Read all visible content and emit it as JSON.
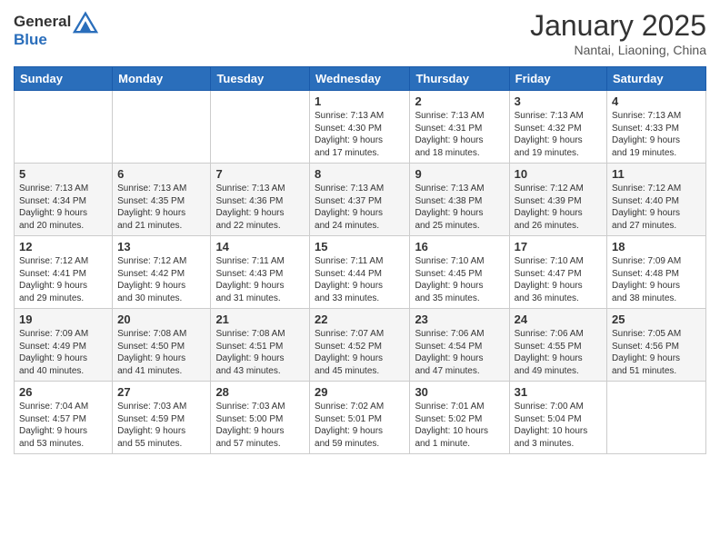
{
  "header": {
    "logo_line1": "General",
    "logo_line2": "Blue",
    "month": "January 2025",
    "location": "Nantai, Liaoning, China"
  },
  "weekdays": [
    "Sunday",
    "Monday",
    "Tuesday",
    "Wednesday",
    "Thursday",
    "Friday",
    "Saturday"
  ],
  "weeks": [
    [
      {
        "day": "",
        "info": ""
      },
      {
        "day": "",
        "info": ""
      },
      {
        "day": "",
        "info": ""
      },
      {
        "day": "1",
        "info": "Sunrise: 7:13 AM\nSunset: 4:30 PM\nDaylight: 9 hours\nand 17 minutes."
      },
      {
        "day": "2",
        "info": "Sunrise: 7:13 AM\nSunset: 4:31 PM\nDaylight: 9 hours\nand 18 minutes."
      },
      {
        "day": "3",
        "info": "Sunrise: 7:13 AM\nSunset: 4:32 PM\nDaylight: 9 hours\nand 19 minutes."
      },
      {
        "day": "4",
        "info": "Sunrise: 7:13 AM\nSunset: 4:33 PM\nDaylight: 9 hours\nand 19 minutes."
      }
    ],
    [
      {
        "day": "5",
        "info": "Sunrise: 7:13 AM\nSunset: 4:34 PM\nDaylight: 9 hours\nand 20 minutes."
      },
      {
        "day": "6",
        "info": "Sunrise: 7:13 AM\nSunset: 4:35 PM\nDaylight: 9 hours\nand 21 minutes."
      },
      {
        "day": "7",
        "info": "Sunrise: 7:13 AM\nSunset: 4:36 PM\nDaylight: 9 hours\nand 22 minutes."
      },
      {
        "day": "8",
        "info": "Sunrise: 7:13 AM\nSunset: 4:37 PM\nDaylight: 9 hours\nand 24 minutes."
      },
      {
        "day": "9",
        "info": "Sunrise: 7:13 AM\nSunset: 4:38 PM\nDaylight: 9 hours\nand 25 minutes."
      },
      {
        "day": "10",
        "info": "Sunrise: 7:12 AM\nSunset: 4:39 PM\nDaylight: 9 hours\nand 26 minutes."
      },
      {
        "day": "11",
        "info": "Sunrise: 7:12 AM\nSunset: 4:40 PM\nDaylight: 9 hours\nand 27 minutes."
      }
    ],
    [
      {
        "day": "12",
        "info": "Sunrise: 7:12 AM\nSunset: 4:41 PM\nDaylight: 9 hours\nand 29 minutes."
      },
      {
        "day": "13",
        "info": "Sunrise: 7:12 AM\nSunset: 4:42 PM\nDaylight: 9 hours\nand 30 minutes."
      },
      {
        "day": "14",
        "info": "Sunrise: 7:11 AM\nSunset: 4:43 PM\nDaylight: 9 hours\nand 31 minutes."
      },
      {
        "day": "15",
        "info": "Sunrise: 7:11 AM\nSunset: 4:44 PM\nDaylight: 9 hours\nand 33 minutes."
      },
      {
        "day": "16",
        "info": "Sunrise: 7:10 AM\nSunset: 4:45 PM\nDaylight: 9 hours\nand 35 minutes."
      },
      {
        "day": "17",
        "info": "Sunrise: 7:10 AM\nSunset: 4:47 PM\nDaylight: 9 hours\nand 36 minutes."
      },
      {
        "day": "18",
        "info": "Sunrise: 7:09 AM\nSunset: 4:48 PM\nDaylight: 9 hours\nand 38 minutes."
      }
    ],
    [
      {
        "day": "19",
        "info": "Sunrise: 7:09 AM\nSunset: 4:49 PM\nDaylight: 9 hours\nand 40 minutes."
      },
      {
        "day": "20",
        "info": "Sunrise: 7:08 AM\nSunset: 4:50 PM\nDaylight: 9 hours\nand 41 minutes."
      },
      {
        "day": "21",
        "info": "Sunrise: 7:08 AM\nSunset: 4:51 PM\nDaylight: 9 hours\nand 43 minutes."
      },
      {
        "day": "22",
        "info": "Sunrise: 7:07 AM\nSunset: 4:52 PM\nDaylight: 9 hours\nand 45 minutes."
      },
      {
        "day": "23",
        "info": "Sunrise: 7:06 AM\nSunset: 4:54 PM\nDaylight: 9 hours\nand 47 minutes."
      },
      {
        "day": "24",
        "info": "Sunrise: 7:06 AM\nSunset: 4:55 PM\nDaylight: 9 hours\nand 49 minutes."
      },
      {
        "day": "25",
        "info": "Sunrise: 7:05 AM\nSunset: 4:56 PM\nDaylight: 9 hours\nand 51 minutes."
      }
    ],
    [
      {
        "day": "26",
        "info": "Sunrise: 7:04 AM\nSunset: 4:57 PM\nDaylight: 9 hours\nand 53 minutes."
      },
      {
        "day": "27",
        "info": "Sunrise: 7:03 AM\nSunset: 4:59 PM\nDaylight: 9 hours\nand 55 minutes."
      },
      {
        "day": "28",
        "info": "Sunrise: 7:03 AM\nSunset: 5:00 PM\nDaylight: 9 hours\nand 57 minutes."
      },
      {
        "day": "29",
        "info": "Sunrise: 7:02 AM\nSunset: 5:01 PM\nDaylight: 9 hours\nand 59 minutes."
      },
      {
        "day": "30",
        "info": "Sunrise: 7:01 AM\nSunset: 5:02 PM\nDaylight: 10 hours\nand 1 minute."
      },
      {
        "day": "31",
        "info": "Sunrise: 7:00 AM\nSunset: 5:04 PM\nDaylight: 10 hours\nand 3 minutes."
      },
      {
        "day": "",
        "info": ""
      }
    ]
  ]
}
